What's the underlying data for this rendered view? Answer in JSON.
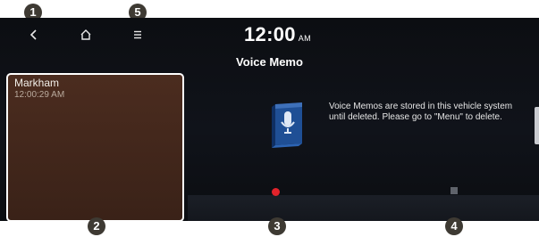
{
  "status": {
    "time": "12:00",
    "ampm": "AM"
  },
  "page_title": "Voice Memo",
  "icons": {
    "back": "back-arrow-icon",
    "home": "home-icon",
    "menu": "menu-icon",
    "memo": "voice-memo-book-icon"
  },
  "memo_list": [
    {
      "name": "Markham",
      "time": "12:00:29 AM"
    }
  ],
  "message": "Voice Memos are stored in this vehicle system until deleted. Please go to \"Menu\" to delete.",
  "controls": {
    "record": "record-icon",
    "stop": "stop-icon"
  },
  "callouts": [
    "1",
    "2",
    "3",
    "4",
    "5"
  ],
  "colors": {
    "record": "#e2232b",
    "memo_card": "#4b2c1f",
    "callout": "#3e3a33"
  }
}
